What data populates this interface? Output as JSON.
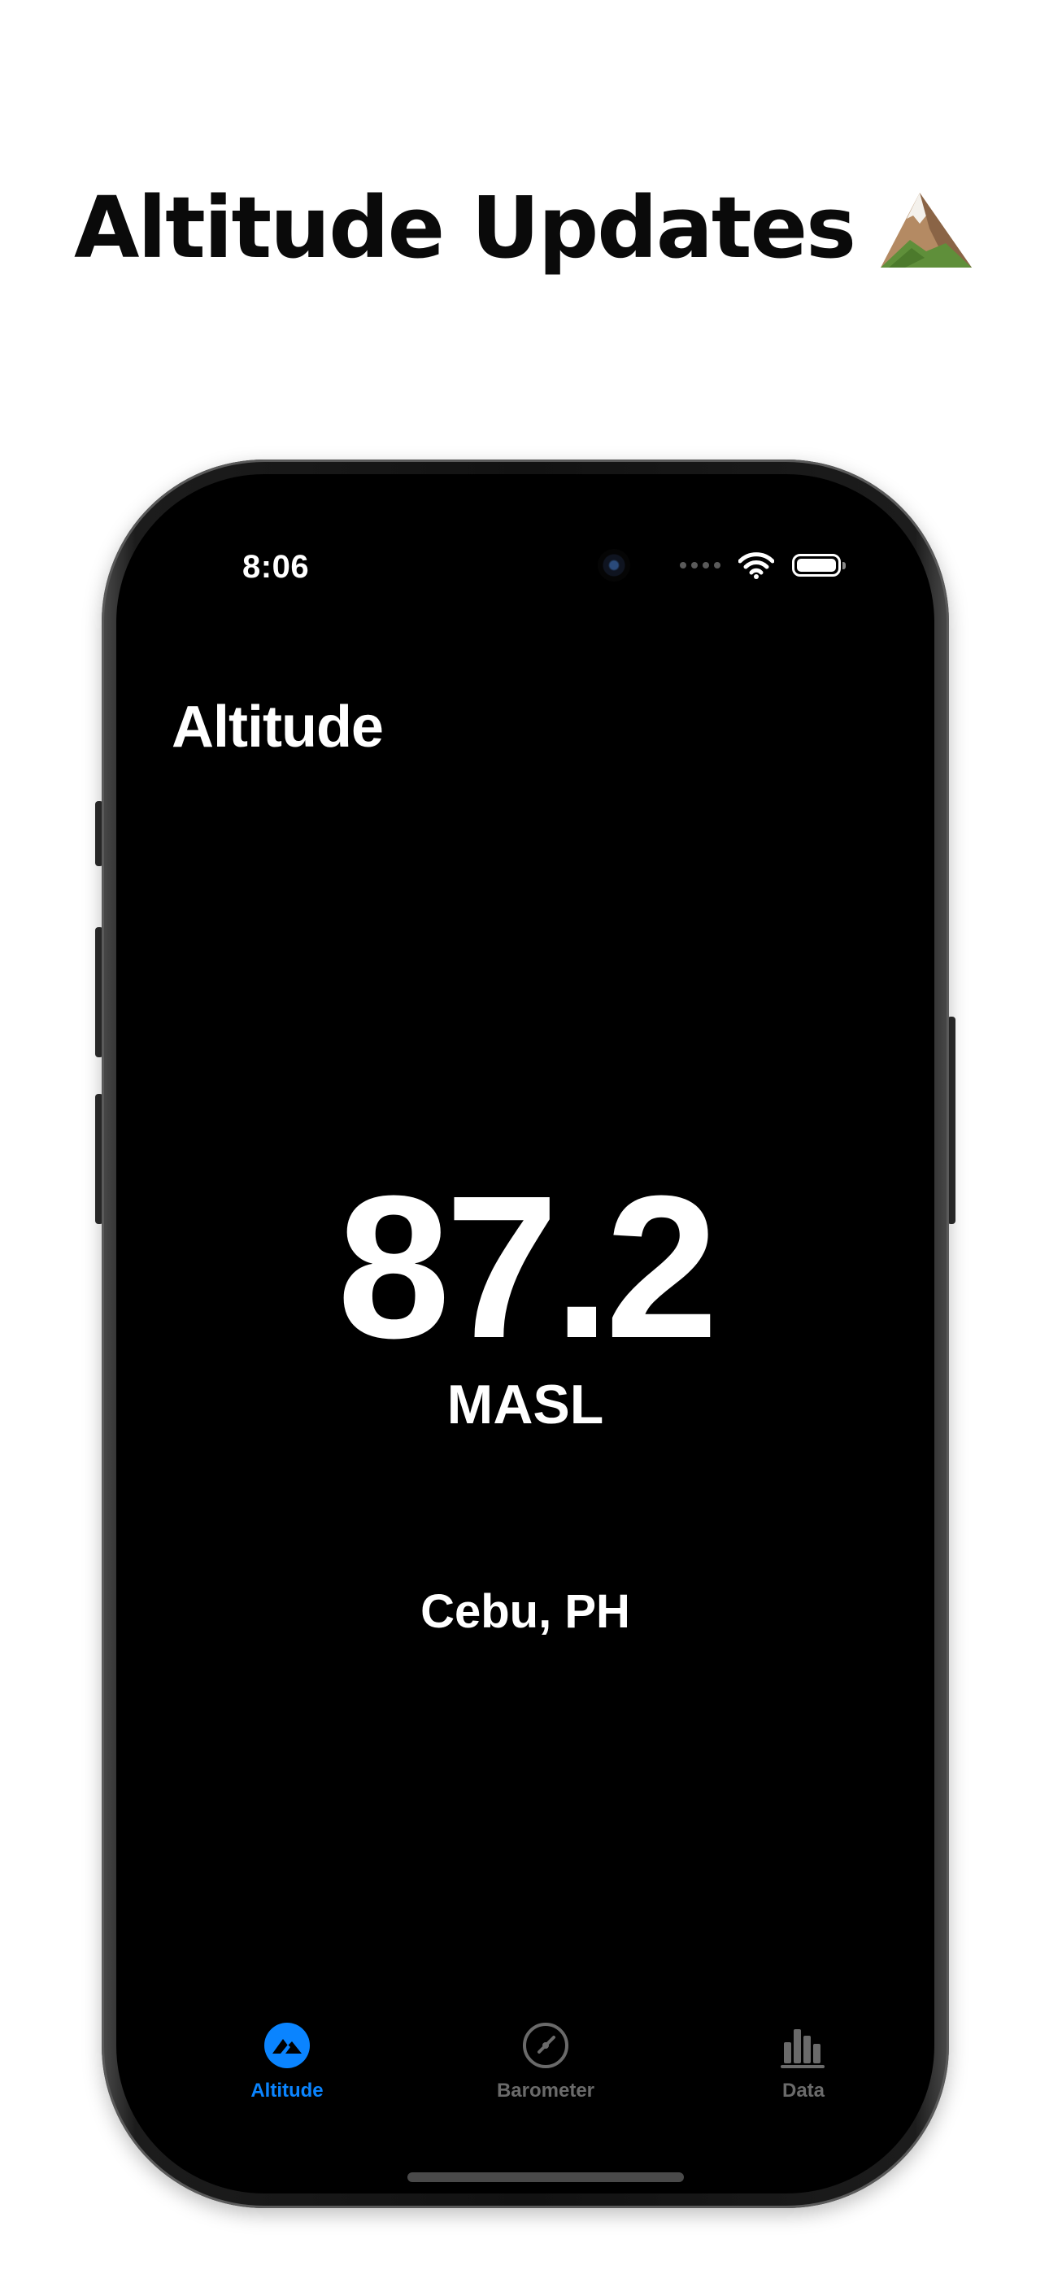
{
  "headline": {
    "text": "Altitude Updates",
    "emoji": "mountain-emoji"
  },
  "status_bar": {
    "time": "8:06",
    "icons": [
      "camera-dot",
      "signal-dots-icon",
      "wifi-icon",
      "battery-icon"
    ]
  },
  "app": {
    "nav_title": "Altitude",
    "altitude_value": "87.2",
    "altitude_unit": "MASL",
    "location": "Cebu, PH"
  },
  "tabs": [
    {
      "label": "Altitude",
      "icon": "mountain-icon",
      "active": true
    },
    {
      "label": "Barometer",
      "icon": "gauge-icon",
      "active": false
    },
    {
      "label": "Data",
      "icon": "bar-chart-icon",
      "active": false
    }
  ],
  "colors": {
    "accent": "#0a84ff",
    "screen_background": "#000000",
    "inactive_tab": "#6a6a6a",
    "text_primary": "#ffffff"
  }
}
